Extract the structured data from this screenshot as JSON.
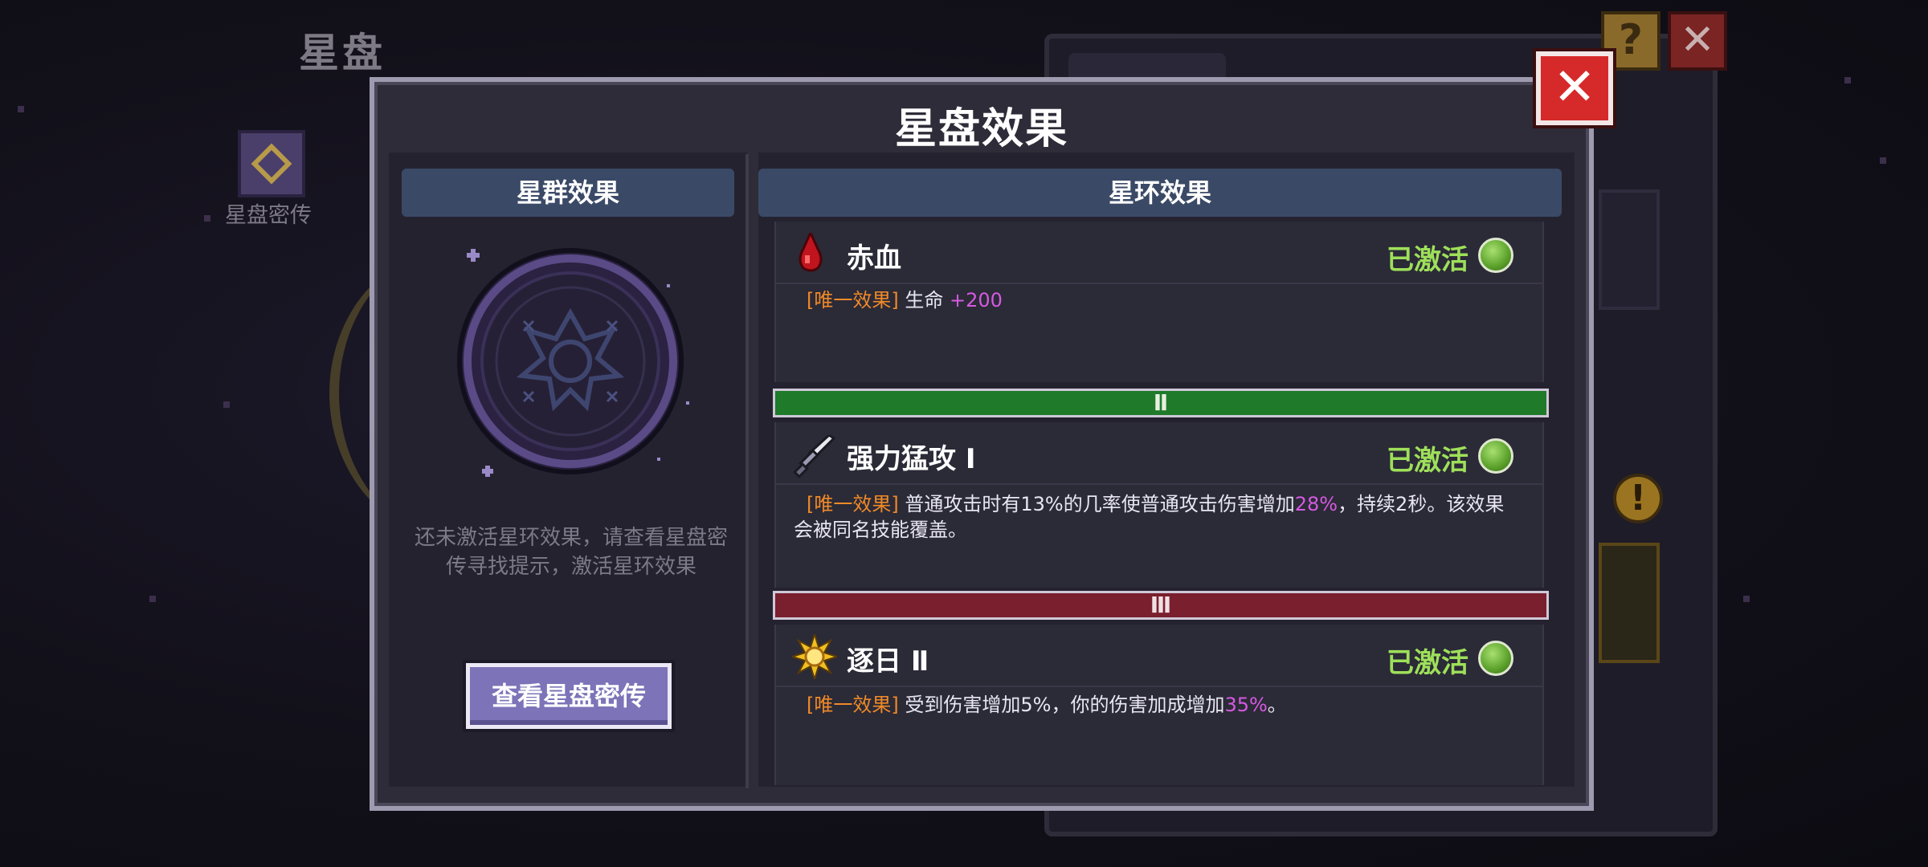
{
  "background": {
    "title": "星盘",
    "secret_label": "星盘密传",
    "help_glyph": "?",
    "close_glyph": "✕",
    "warn_glyph": "!"
  },
  "dialog": {
    "title": "星盘效果",
    "close_glyph": "✕",
    "left": {
      "header": "星群效果",
      "hint_line1": "还未激活星环效果，请查看星盘密",
      "hint_line2": "传寻找提示，激活星环效果",
      "button": "查看星盘密传"
    },
    "right": {
      "header": "星环效果",
      "effects": [
        {
          "icon": "blood-drop-icon",
          "name": "赤血",
          "status": "已激活",
          "tag": "[唯一效果]",
          "desc_text": "生命",
          "desc_value": "+200"
        },
        {
          "tier": "Ⅱ",
          "icon": "sword-icon",
          "name": "强力猛攻 Ⅰ",
          "status": "已激活",
          "tag": "[唯一效果]",
          "desc_pre": "普通攻击时有13%的几率使普通攻击伤害增加",
          "desc_value": "28%",
          "desc_post": "，持续2秒。该效果",
          "desc_line2": "会被同名技能覆盖。"
        },
        {
          "tier": "Ⅲ",
          "icon": "sun-icon",
          "name": "逐日 Ⅱ",
          "status": "已激活",
          "tag": "[唯一效果]",
          "desc_pre": "受到伤害增加5%，你的伤害加成增加",
          "desc_value": "35%",
          "desc_post": "。"
        }
      ]
    }
  },
  "colors": {
    "active_green": "#9ee05a",
    "tag_orange": "#f08a28",
    "value_pink": "#d45ae0",
    "tier2_green": "#1f7a2a",
    "tier3_red": "#7a1f2e",
    "close_red": "#d62a2a",
    "button_purple": "#7c73b8"
  }
}
